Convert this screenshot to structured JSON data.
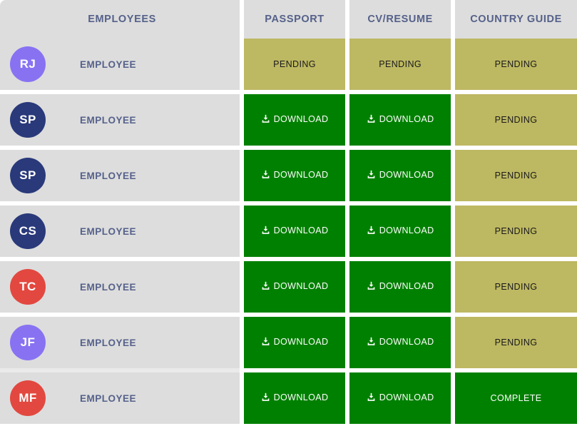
{
  "table": {
    "columns": [
      {
        "key": "employees",
        "label": "EMPLOYEES"
      },
      {
        "key": "passport",
        "label": "PASSPORT"
      },
      {
        "key": "cv_resume",
        "label": "CV/RESUME"
      },
      {
        "key": "country_guide",
        "label": "COUNTRY GUIDE"
      }
    ],
    "labels": {
      "pending": "PENDING",
      "download": "DOWNLOAD",
      "complete": "COMPLETE"
    },
    "icons": {
      "download": "download-icon"
    },
    "colors": {
      "header_bg": "#dddddd",
      "header_text": "#55618a",
      "row_bg": "#dddddd",
      "name_text": "#55618a",
      "pending_bg": "#bdb862",
      "pending_text": "#1a1a1a",
      "green_bg": "#008000",
      "green_text": "#ffffff",
      "page_bg": "#ffffff"
    },
    "rows": [
      {
        "avatar": {
          "initials": "RJ",
          "color": "#8872f2"
        },
        "name": "EMPLOYEE",
        "passport": "pending",
        "cv_resume": "pending",
        "country_guide": "pending"
      },
      {
        "avatar": {
          "initials": "SP",
          "color": "#29397a"
        },
        "name": "EMPLOYEE",
        "passport": "download",
        "cv_resume": "download",
        "country_guide": "pending"
      },
      {
        "avatar": {
          "initials": "SP",
          "color": "#29397a"
        },
        "name": "EMPLOYEE",
        "passport": "download",
        "cv_resume": "download",
        "country_guide": "pending"
      },
      {
        "avatar": {
          "initials": "CS",
          "color": "#29397a"
        },
        "name": "EMPLOYEE",
        "passport": "download",
        "cv_resume": "download",
        "country_guide": "pending"
      },
      {
        "avatar": {
          "initials": "TC",
          "color": "#e2483f"
        },
        "name": "EMPLOYEE",
        "passport": "download",
        "cv_resume": "download",
        "country_guide": "pending"
      },
      {
        "avatar": {
          "initials": "JF",
          "color": "#8872f2"
        },
        "name": "EMPLOYEE",
        "passport": "download",
        "cv_resume": "download",
        "country_guide": "pending"
      },
      {
        "avatar": {
          "initials": "MF",
          "color": "#e2483f"
        },
        "name": "EMPLOYEE",
        "passport": "download",
        "cv_resume": "download",
        "country_guide": "complete"
      }
    ]
  }
}
